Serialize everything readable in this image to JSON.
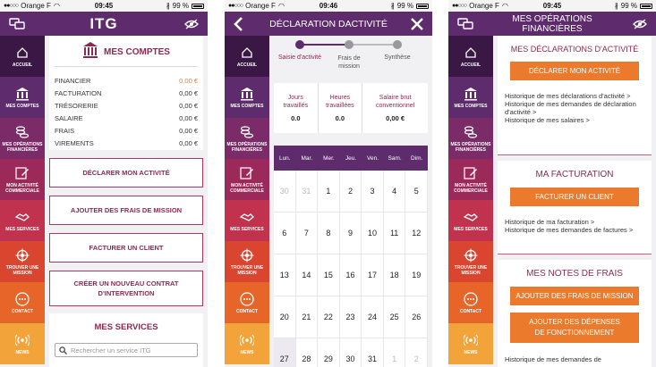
{
  "status": {
    "carrier": "Orange F",
    "battery": "99 %",
    "times": [
      "09:45",
      "09:46",
      "09:45"
    ]
  },
  "sidebar": {
    "items": [
      {
        "label": "ACCUEIL",
        "icon": "home-icon",
        "color": "#3a1744"
      },
      {
        "label": "MES COMPTES",
        "icon": "bank-icon",
        "color": "#5e2b6c"
      },
      {
        "label": "MES OPÉRATIONS FINANCIÈRES",
        "icon": "coins-icon",
        "color": "#7a2b68"
      },
      {
        "label": "MON ACTIVITÉ COMMERCIALE",
        "icon": "edit-icon",
        "color": "#9b2a5a"
      },
      {
        "label": "MES SERVICES",
        "icon": "handshake-icon",
        "color": "#c0324d"
      },
      {
        "label": "TROUVER UNE MISSION",
        "icon": "target-icon",
        "color": "#d9452f"
      },
      {
        "label": "CONTACT",
        "icon": "chat-icon",
        "color": "#e8652a"
      },
      {
        "label": "NEWS",
        "icon": "broadcast-icon",
        "color": "#f2a43a"
      }
    ]
  },
  "screen1": {
    "logo": "ITG",
    "comptes_title": "MES COMPTES",
    "accounts": [
      {
        "name": "FINANCIER",
        "value": "0,00 €",
        "accent": true
      },
      {
        "name": "FACTURATION",
        "value": "0,00 €",
        "accent": false
      },
      {
        "name": "TRÉSORERIE",
        "value": "0,00 €",
        "accent": false
      },
      {
        "name": "SALAIRE",
        "value": "0,00 €",
        "accent": false
      },
      {
        "name": "FRAIS",
        "value": "0,00 €",
        "accent": false
      },
      {
        "name": "VIREMENTS",
        "value": "0,00 €",
        "accent": false
      }
    ],
    "buttons": [
      "DÉCLARER MON ACTIVITÉ",
      "AJOUTER DES FRAIS DE MISSION",
      "FACTURER UN CLIENT",
      "CRÉER UN NOUVEAU CONTRAT D'INTERVENTION"
    ],
    "services_title": "MES SERVICES",
    "search_placeholder": "Rechercher un service ITG"
  },
  "screen2": {
    "title": "DÉCLARATION DACTIVITÉ",
    "steps": [
      "Saisie d'activité",
      "Frais de mission",
      "Synthèse"
    ],
    "summary": [
      {
        "label": "Jours travaillés",
        "value": "0.0"
      },
      {
        "label": "Heures travaillées",
        "value": "0.0"
      },
      {
        "label": "Salaire brut conventionnel",
        "value": "0,00 €"
      }
    ],
    "weekdays": [
      "Lun.",
      "Mar.",
      "Mer.",
      "Jeu.",
      "Ven.",
      "Sam.",
      "Dim."
    ],
    "days": [
      "30",
      "31",
      "1",
      "2",
      "3",
      "4",
      "5",
      "6",
      "7",
      "8",
      "9",
      "10",
      "11",
      "12",
      "13",
      "14",
      "15",
      "16",
      "17",
      "18",
      "19",
      "20",
      "21",
      "22",
      "23",
      "24",
      "25",
      "26",
      "27",
      "28",
      "29",
      "30",
      "31",
      "1",
      "2"
    ],
    "muted_days": [
      0,
      1,
      33,
      34
    ]
  },
  "screen3": {
    "title": "MES OPÉRATIONS FINANCIÈRES",
    "declarations_title": "MES DÉCLARATIONS D'ACTIVITÉ",
    "declare_button": "DÉCLARER MON ACTIVITÉ",
    "declarations_links": [
      "Historique de mes déclarations d'activité >",
      "Historique de mes demandes de déclaration d'activité >",
      "Historique de mes salaires >"
    ],
    "facturation_title": "MA FACTURATION",
    "facturer_button": "FACTURER UN CLIENT",
    "facturation_links": [
      "Historique de ma facturation >",
      "Historique de mes demandes de factures >"
    ],
    "frais_title": "MES NOTES DE FRAIS",
    "frais_button": "AJOUTER DES FRAIS DE MISSION",
    "depenses_button": "AJOUTER DES DÉPENSES DE FONCTIONNEMENT",
    "frais_link": "Historique de mes demandes de"
  }
}
